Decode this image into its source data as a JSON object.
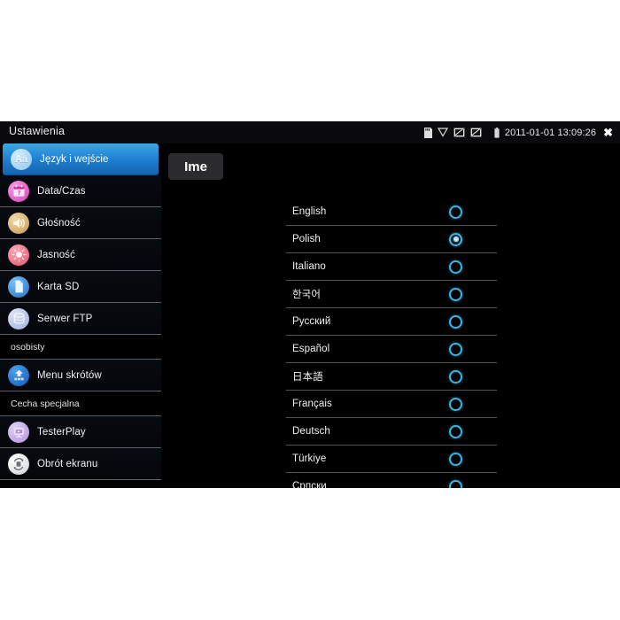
{
  "window": {
    "title": "Ustawienia",
    "close_label": "✖"
  },
  "statusbar": {
    "icons": [
      "sd-card-icon",
      "signal-triangle-icon",
      "display-off-icon",
      "display-off-icon-2",
      "battery-icon"
    ],
    "datetime": "2011-01-01 13:09:26"
  },
  "sidebar": {
    "items": [
      {
        "label": "Język i wejście",
        "icon": "language-icon",
        "selected": true,
        "color": "#a8d8f5",
        "glyph": "Aa"
      },
      {
        "label": "Data/Czas",
        "icon": "calendar-icon",
        "selected": false,
        "color": "#e85fc8",
        "glyph": "7"
      },
      {
        "label": "Głośność",
        "icon": "volume-icon",
        "selected": false,
        "color": "#d8ac6a",
        "glyph": ""
      },
      {
        "label": "Jasność",
        "icon": "brightness-icon",
        "selected": false,
        "color": "#e8748a",
        "glyph": ""
      },
      {
        "label": "Karta SD",
        "icon": "sd-card-icon",
        "selected": false,
        "color": "#3f93e0",
        "glyph": ""
      },
      {
        "label": "Serwer FTP",
        "icon": "ftp-server-icon",
        "selected": false,
        "color": "#aebfe8",
        "glyph": ""
      }
    ],
    "sections": [
      {
        "label": "osobisty"
      },
      {
        "label": "Cecha specjalna"
      }
    ],
    "personal_items": [
      {
        "label": "Menu skrótów",
        "icon": "shortcut-menu-icon",
        "selected": false,
        "color": "#1c6fd0",
        "glyph": ""
      }
    ],
    "special_items": [
      {
        "label": "TesterPlay",
        "icon": "tester-play-icon",
        "selected": false,
        "color": "#c9a8ea",
        "glyph": ""
      },
      {
        "label": "Obrót ekranu",
        "icon": "screen-rotate-icon",
        "selected": false,
        "color": "#e8e8e8",
        "glyph": ""
      }
    ]
  },
  "content": {
    "tab_label": "Ime",
    "languages": [
      {
        "name": "English",
        "selected": false
      },
      {
        "name": "Polish",
        "selected": true
      },
      {
        "name": "Italiano",
        "selected": false
      },
      {
        "name": "한국어",
        "selected": false
      },
      {
        "name": "Русский",
        "selected": false
      },
      {
        "name": "Español",
        "selected": false
      },
      {
        "name": "日本語",
        "selected": false
      },
      {
        "name": "Français",
        "selected": false
      },
      {
        "name": "Deutsch",
        "selected": false
      },
      {
        "name": "Türkiye",
        "selected": false
      },
      {
        "name": "Српски",
        "selected": false
      }
    ]
  },
  "colors": {
    "accent_blue": "#1f7fd0",
    "radio_cyan": "#38b6e8",
    "panel_black": "#000000",
    "divider": "#5b6068"
  }
}
